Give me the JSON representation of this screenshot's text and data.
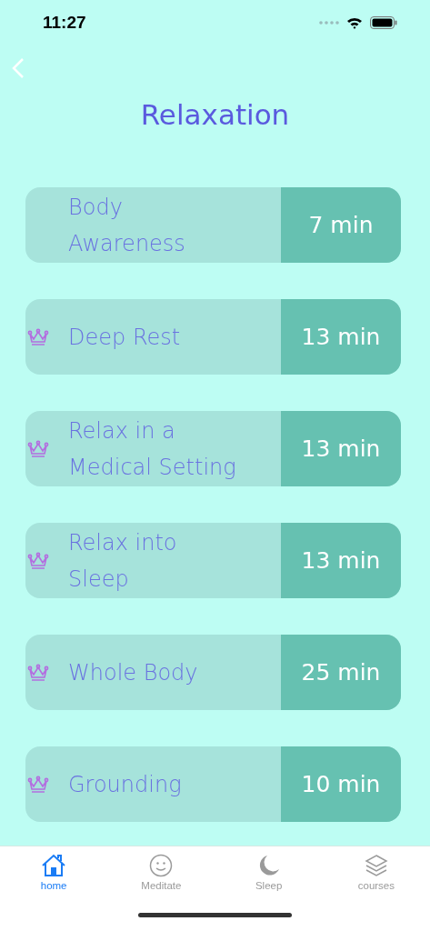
{
  "status_bar": {
    "time": "11:27"
  },
  "title": "Relaxation",
  "sessions": [
    {
      "name": "Body\nAwareness",
      "duration": "7 min",
      "premium": false
    },
    {
      "name": "Deep Rest",
      "duration": "13 min",
      "premium": true
    },
    {
      "name": "Relax in a\nMedical Setting",
      "duration": "13 min",
      "premium": true
    },
    {
      "name": "Relax into\nSleep",
      "duration": "13 min",
      "premium": true
    },
    {
      "name": "Whole Body",
      "duration": "25 min",
      "premium": true
    },
    {
      "name": "Grounding",
      "duration": "10 min",
      "premium": true
    }
  ],
  "tabs": [
    {
      "kind": "home",
      "label": "home",
      "selected": true
    },
    {
      "kind": "meditate",
      "label": "Meditate",
      "selected": false
    },
    {
      "kind": "sleep",
      "label": "Sleep",
      "selected": false
    },
    {
      "kind": "courses",
      "label": "courses",
      "selected": false
    }
  ]
}
